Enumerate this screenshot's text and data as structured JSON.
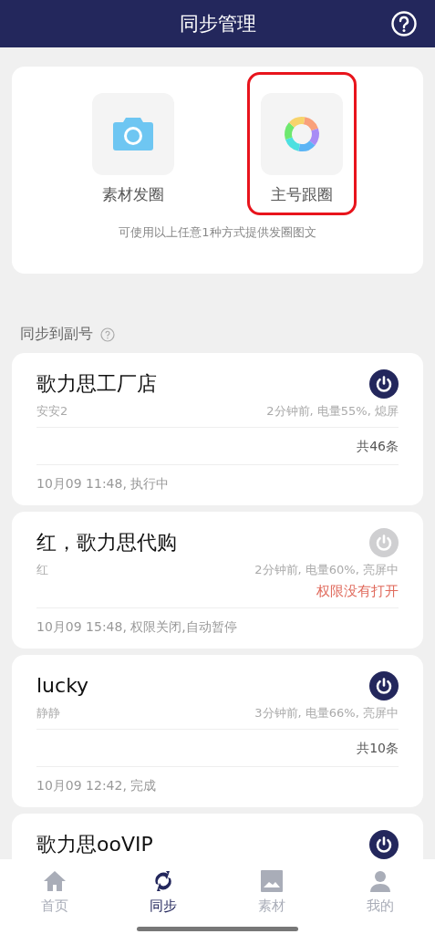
{
  "header": {
    "title": "同步管理"
  },
  "sources": {
    "options": [
      {
        "label": "素材发圈",
        "selected": false
      },
      {
        "label": "主号跟圈",
        "selected": true
      }
    ],
    "hint": "可使用以上任意1种方式提供发圈图文"
  },
  "section": {
    "title": "同步到副号"
  },
  "accounts": [
    {
      "name": "歌力思工厂店",
      "on": true,
      "owner": "安安2",
      "status": "2分钟前, 电量55%, 熄屏",
      "count": "共46条",
      "log": "10月09 11:48, 执行中"
    },
    {
      "name": "红，歌力思代购",
      "on": false,
      "owner": "红",
      "status": "2分钟前, 电量60%, 亮屏中",
      "warning": "权限没有打开",
      "log": "10月09 15:48, 权限关闭,自动暂停"
    },
    {
      "name": "lucky",
      "on": true,
      "owner": "静静",
      "status": "3分钟前, 电量66%, 亮屏中",
      "count": "共10条",
      "log": "10月09 12:42, 完成"
    },
    {
      "name": "歌力思ooVIP",
      "on": true
    }
  ],
  "tabs": [
    {
      "label": "首页",
      "selected": false
    },
    {
      "label": "同步",
      "selected": true
    },
    {
      "label": "素材",
      "selected": false
    },
    {
      "label": "我的",
      "selected": false
    }
  ]
}
